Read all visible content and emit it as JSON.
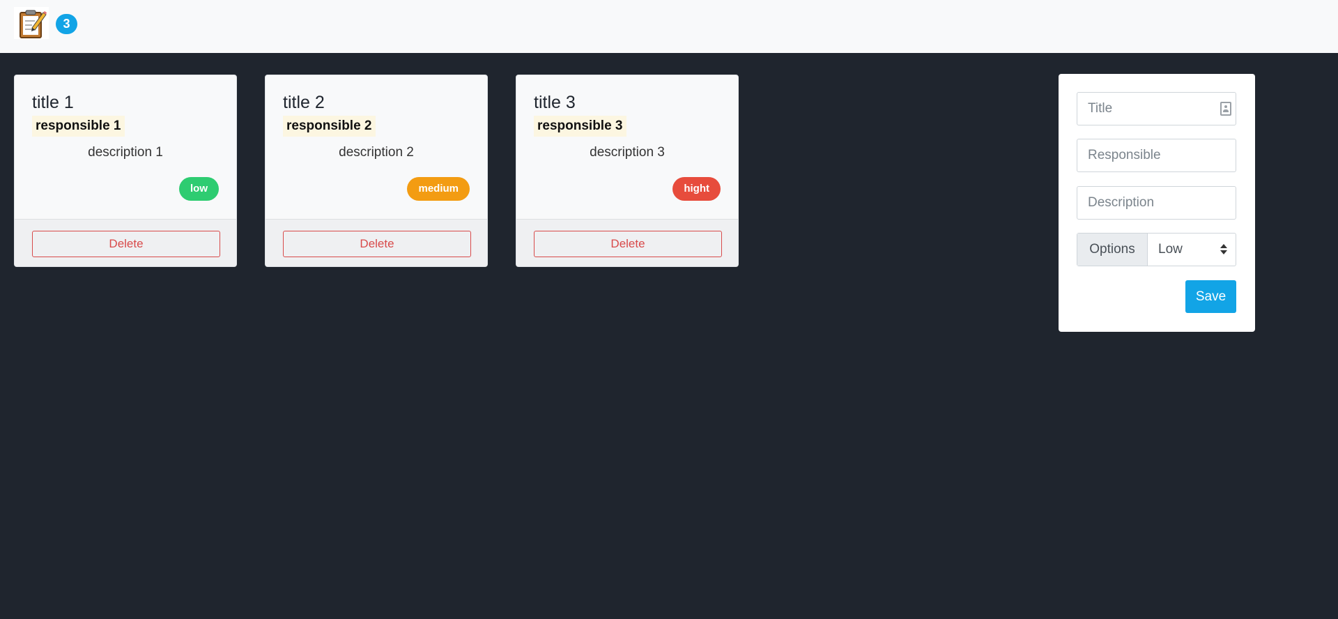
{
  "navbar": {
    "logo_icon": "clipboard-pencil-icon",
    "count_badge": "3"
  },
  "cards": [
    {
      "title": "title 1",
      "responsible": "responsible 1",
      "description": "description 1",
      "priority": "low",
      "priority_color": "#2ecc71",
      "delete_label": "Delete"
    },
    {
      "title": "title 2",
      "responsible": "responsible 2",
      "description": "description 2",
      "priority": "medium",
      "priority_color": "#f39c12",
      "delete_label": "Delete"
    },
    {
      "title": "title 3",
      "responsible": "responsible 3",
      "description": "description 3",
      "priority": "hight",
      "priority_color": "#e74c3c",
      "delete_label": "Delete"
    }
  ],
  "form": {
    "title_placeholder": "Title",
    "title_icon": "contact-card-icon",
    "responsible_placeholder": "Responsible",
    "description_placeholder": "Description",
    "options_label": "Options",
    "options_selected": "Low",
    "save_label": "Save"
  },
  "colors": {
    "background": "#1f252e",
    "accent": "#12a4e6",
    "danger": "#d84a4a"
  }
}
